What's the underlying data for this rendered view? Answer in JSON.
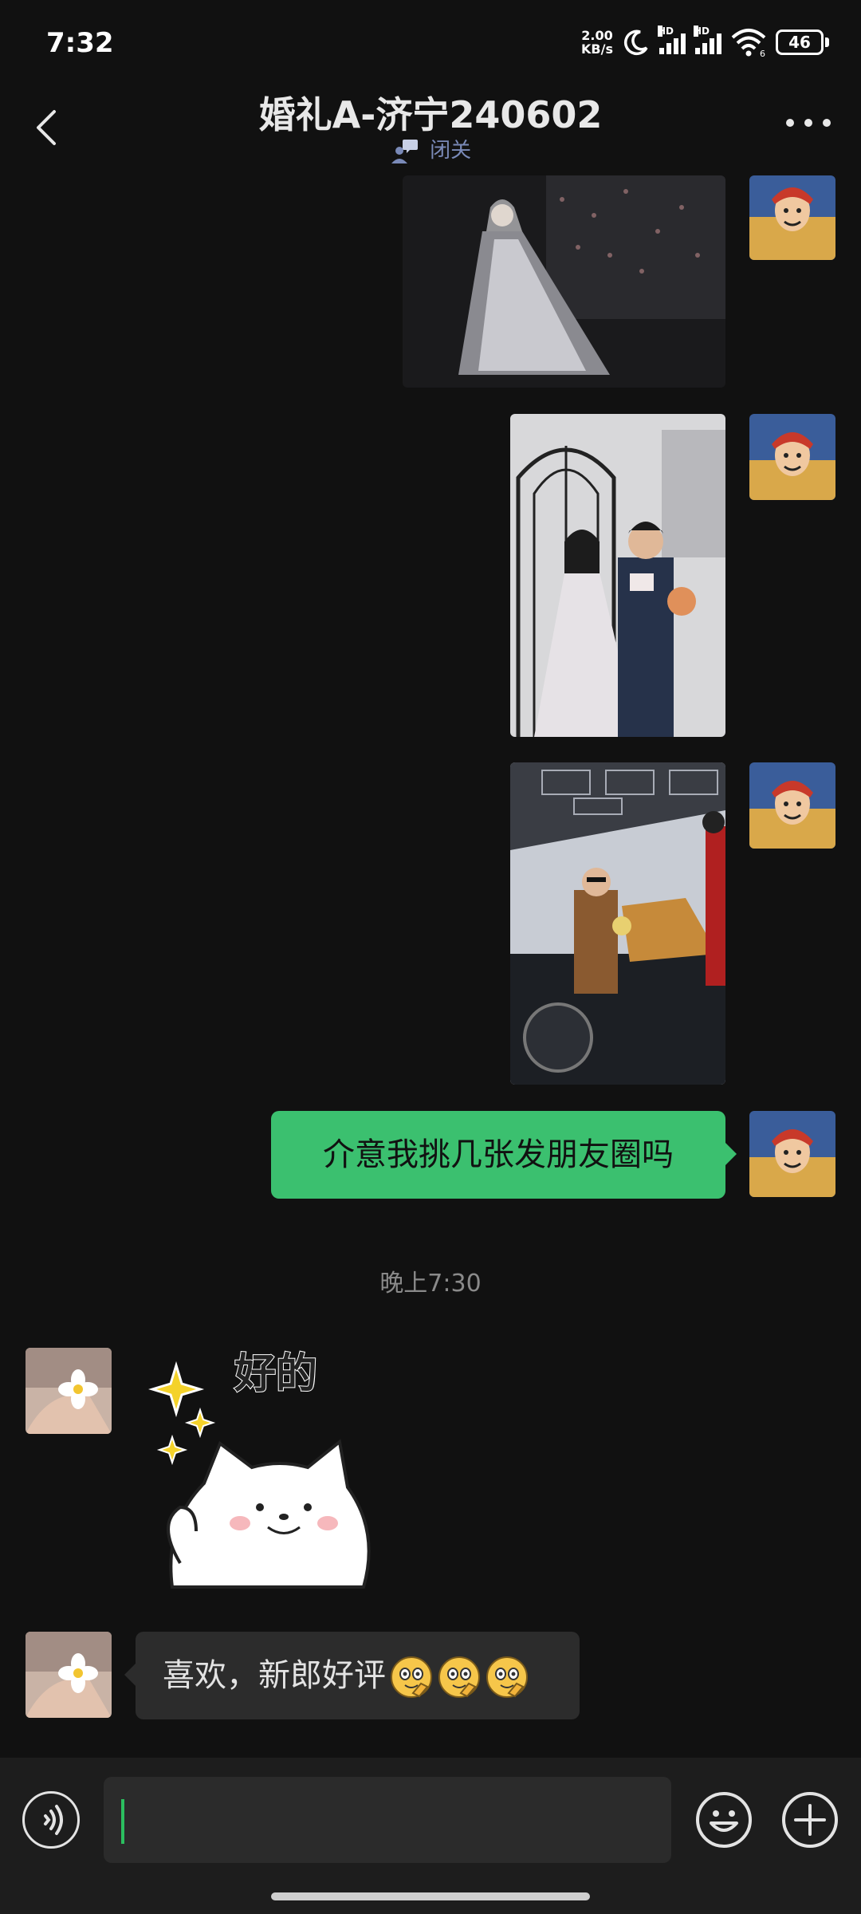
{
  "status_bar": {
    "time": "7:32",
    "net_speed_value": "2.00",
    "net_speed_unit": "KB/s",
    "hd_1": "HD",
    "hd_2": "HD",
    "battery": "46",
    "wifi_sub": "6"
  },
  "header": {
    "title": "婚礼A-济宁240602",
    "subtitle": "闭关"
  },
  "messages": {
    "sent_text": "介意我挑几张发朋友圈吗",
    "time_separator": "晚上7:30",
    "sticker_text": "好的",
    "received_text": "喜欢，新郎好评"
  },
  "input": {
    "placeholder": ""
  },
  "colors": {
    "background": "#111111",
    "sent_bubble": "#3bc06f",
    "received_bubble": "#2c2c2c",
    "input_bar": "#1d1d1d"
  }
}
